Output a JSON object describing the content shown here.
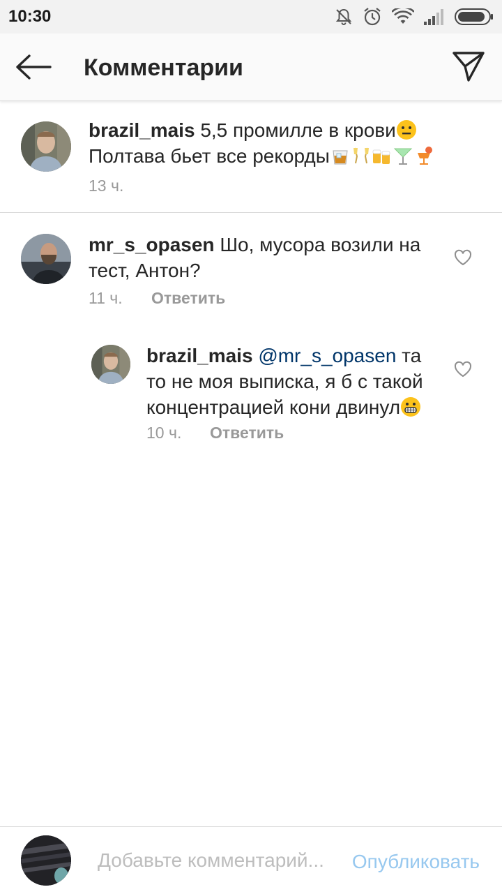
{
  "status_bar": {
    "time": "10:30"
  },
  "header": {
    "title": "Комментарии"
  },
  "comments": [
    {
      "username": "brazil_mais",
      "text_line1": "5,5 промилле в крови",
      "text_line2": "Полтава бьет все рекорды",
      "time": "13 ч."
    },
    {
      "username": "mr_s_opasen",
      "text_line1": "Шо, мусора возили на",
      "text_line2": "тест, Антон?",
      "time": "11 ч.",
      "reply_label": "Ответить"
    },
    {
      "username": "brazil_mais",
      "mention": "@mr_s_opasen",
      "text_line1": "та",
      "text_line2": "то не моя выписка, я б с такой",
      "text_line3": "концентрацией кони двинул",
      "time": "10 ч.",
      "reply_label": "Ответить"
    }
  ],
  "composer": {
    "placeholder": "Добавьте комментарий...",
    "publish_label": "Опубликовать"
  },
  "icons": {
    "status": [
      "notifications-off-icon",
      "alarm-icon",
      "wifi-icon",
      "signal-icon",
      "battery-icon"
    ],
    "header": [
      "back-arrow-icon",
      "send-icon"
    ],
    "comment": [
      "heart-icon"
    ],
    "emoji": [
      "neutral-face-emoji",
      "whiskey-emoji",
      "champagne-emoji",
      "beer-mugs-emoji",
      "cocktail-emoji",
      "tropical-drink-emoji",
      "grimacing-face-emoji"
    ]
  },
  "colors": {
    "mention": "#003569",
    "publish": "#97c8ef",
    "muted": "#999999"
  }
}
